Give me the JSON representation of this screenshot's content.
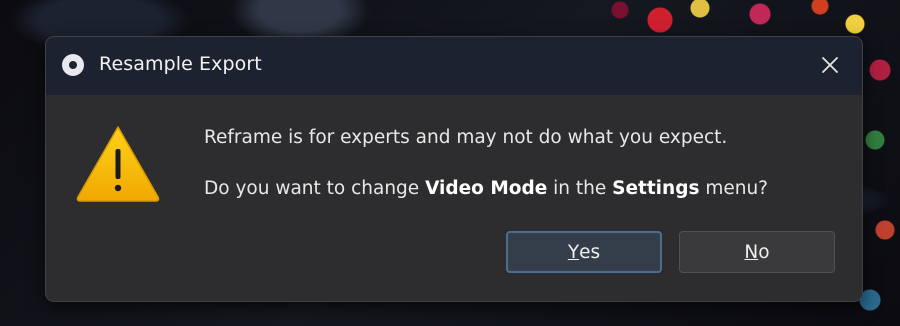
{
  "dialog": {
    "title": "Resample Export",
    "app_icon": "disc-icon",
    "close_icon": "close-icon",
    "warning_icon": "warning-icon",
    "message_line1": "Reframe is for experts and may not do what you expect.",
    "message_line2_prefix": "Do you want to change ",
    "message_line2_bold1": "Video Mode",
    "message_line2_middle": " in the ",
    "message_line2_bold2": "Settings",
    "message_line2_suffix": " menu?",
    "buttons": {
      "yes_mnemonic": "Y",
      "yes_rest": "es",
      "no_mnemonic": "N",
      "no_rest": "o"
    }
  },
  "colors": {
    "titlebar": "#1d2231",
    "body": "#2d2d30",
    "accent_border": "#4a6e8c",
    "warning": "#f5c400"
  }
}
